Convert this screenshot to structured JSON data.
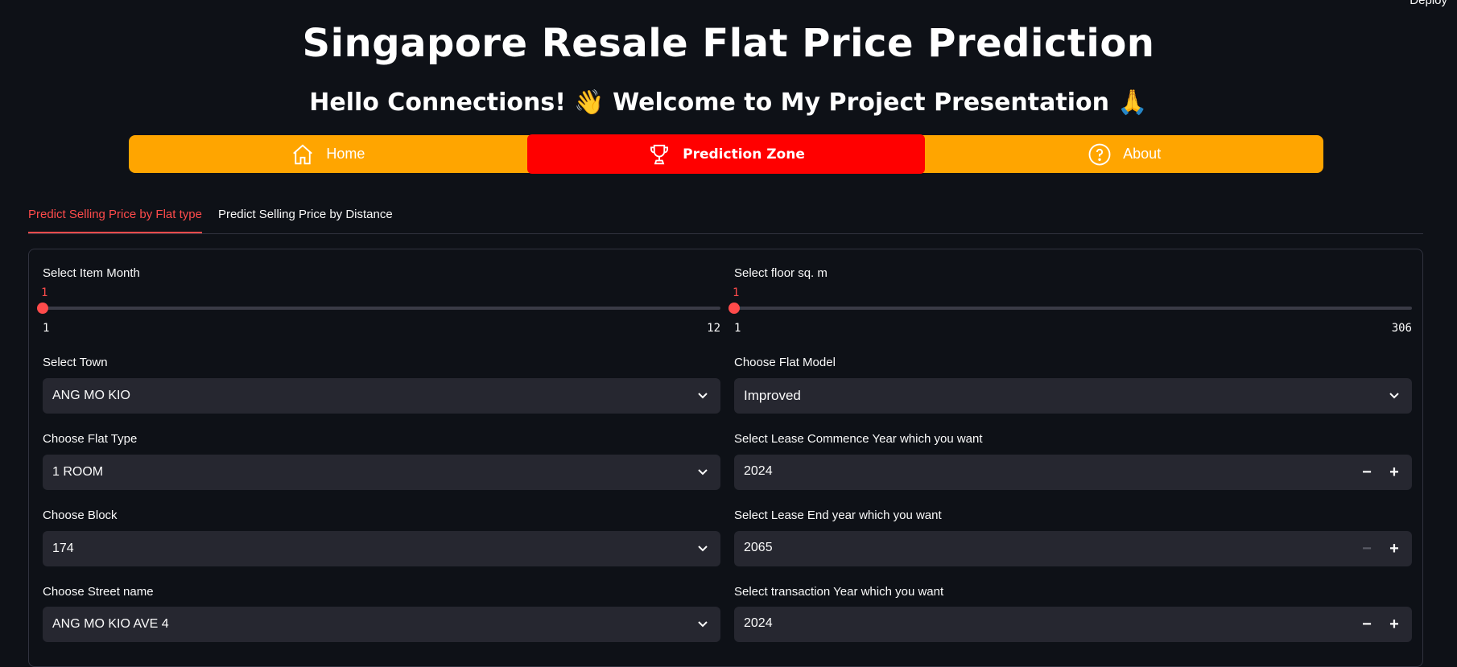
{
  "header": {
    "deploy": "Deploy",
    "title": "Singapore Resale Flat Price Prediction",
    "subtitle": "Hello Connections! 👋 Welcome to My Project Presentation 🙏"
  },
  "nav": {
    "items": [
      {
        "label": "Home",
        "icon": "home-icon"
      },
      {
        "label": "Prediction Zone",
        "icon": "trophy-icon",
        "active": true
      },
      {
        "label": "About",
        "icon": "question-icon"
      }
    ],
    "colors": {
      "bar": "#ffa500",
      "active": "#ff0000"
    }
  },
  "tabs": [
    {
      "label": "Predict Selling Price by Flat type",
      "active": true
    },
    {
      "label": "Predict Selling Price by Distance",
      "active": false
    }
  ],
  "form": {
    "item_month": {
      "label": "Select Item Month",
      "value": "1",
      "min": "1",
      "max": "12"
    },
    "floor_sqm": {
      "label": "Select floor sq. m",
      "value": "1",
      "min": "1",
      "max": "306"
    },
    "town": {
      "label": "Select Town",
      "value": "ANG MO KIO"
    },
    "flat_model": {
      "label": "Choose Flat Model",
      "value": "Improved"
    },
    "flat_type": {
      "label": "Choose Flat Type",
      "value": "1 ROOM"
    },
    "lease_commence": {
      "label": "Select Lease Commence Year which you want",
      "value": "2024"
    },
    "block": {
      "label": "Choose Block",
      "value": "174"
    },
    "lease_end": {
      "label": "Select Lease End year which you want",
      "value": "2065"
    },
    "street": {
      "label": "Choose Street name",
      "value": "ANG MO KIO AVE 4"
    },
    "transaction_year": {
      "label": "Select transaction Year which you want",
      "value": "2024"
    }
  },
  "number_buttons": {
    "minus": "−",
    "plus": "+"
  },
  "accent": "#ff4b4b"
}
